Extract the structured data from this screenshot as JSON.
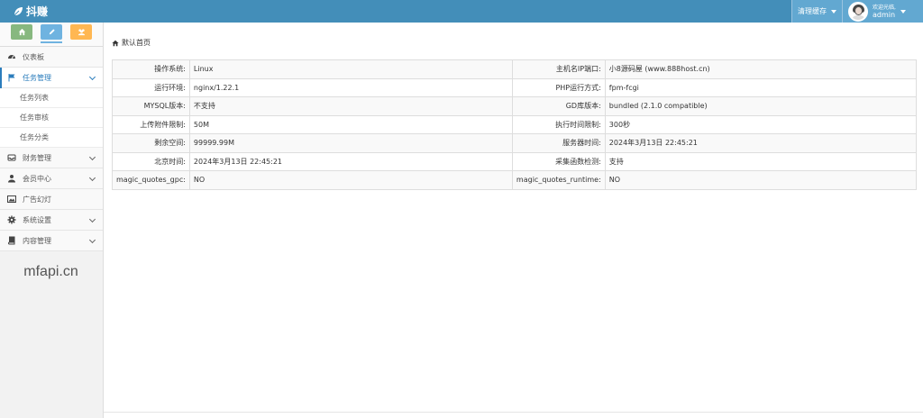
{
  "app": {
    "brand": "抖赚"
  },
  "navbar": {
    "clear_cache": "清理缓存",
    "welcome": "欢迎光临,",
    "username": "admin"
  },
  "sidebar": {
    "items": [
      {
        "label": "仪表板"
      },
      {
        "label": "任务管理",
        "sub": [
          "任务列表",
          "任务审核",
          "任务分类"
        ]
      },
      {
        "label": "财务管理"
      },
      {
        "label": "会员中心"
      },
      {
        "label": "广告幻灯"
      },
      {
        "label": "系统设置"
      },
      {
        "label": "内容管理"
      }
    ],
    "watermark": "mfapi.cn"
  },
  "breadcrumb": "默认首页",
  "info": [
    {
      "k1": "操作系统:",
      "v1": "Linux",
      "k2": "主机名IP端口:",
      "v2": "小8源码屋 (www.888host.cn)"
    },
    {
      "k1": "运行环境:",
      "v1": "nginx/1.22.1",
      "k2": "PHP运行方式:",
      "v2": "fpm-fcgi"
    },
    {
      "k1": "MYSQL版本:",
      "v1": "不支持",
      "k2": "GD库版本:",
      "v2": "bundled (2.1.0 compatible)"
    },
    {
      "k1": "上传附件限制:",
      "v1": "50M",
      "k2": "执行时间限制:",
      "v2": "300秒"
    },
    {
      "k1": "剩余空间:",
      "v1": "99999.99M",
      "k2": "服务器时间:",
      "v2": "2024年3月13日 22:45:21"
    },
    {
      "k1": "北京时间:",
      "v1": "2024年3月13日 22:45:21",
      "k2": "采集函数检测:",
      "v2": "支持"
    },
    {
      "k1": "magic_quotes_gpc:",
      "v1": "NO",
      "k2": "magic_quotes_runtime:",
      "v2": "NO"
    }
  ],
  "colors": {
    "navbar": "#438eb9",
    "accent": "#2b7dbc",
    "shortcut_green": "#87b87f",
    "shortcut_blue": "#6fb3e0",
    "shortcut_orange": "#ffb752"
  }
}
